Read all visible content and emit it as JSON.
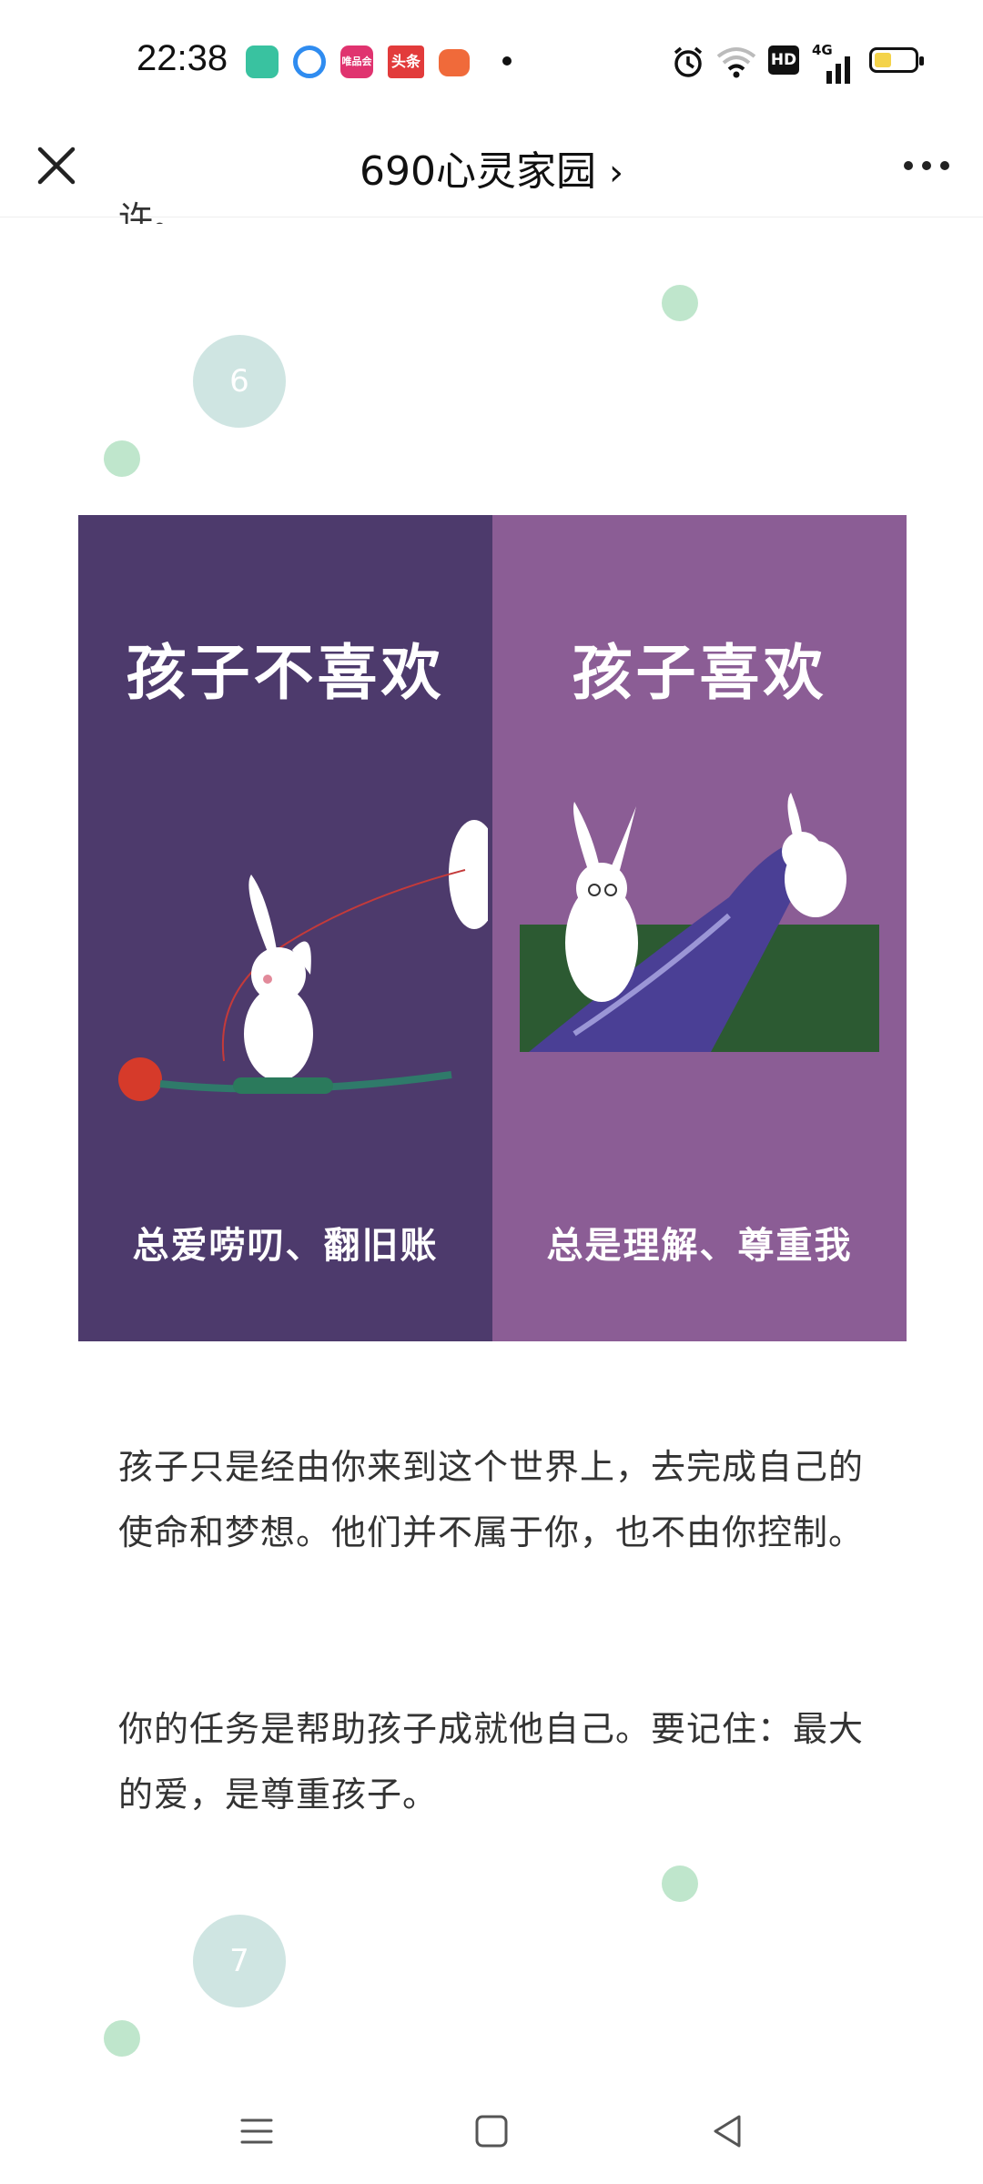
{
  "status": {
    "time": "22:38",
    "apps": [
      {
        "name": "book-app-icon",
        "color": "#39c2a0",
        "label": ""
      },
      {
        "name": "browser-app-icon",
        "color": "#2f8cf0",
        "label": ""
      },
      {
        "name": "vip-app-icon",
        "color": "#e0336f",
        "label": "唯品会"
      },
      {
        "name": "toutiao-app-icon",
        "color": "#e23b3b",
        "label": "头条"
      },
      {
        "name": "game-app-icon",
        "color": "#f06a3a",
        "label": ""
      }
    ],
    "hd_label": "HD",
    "network_label": "4G"
  },
  "header": {
    "title": "690心灵家园",
    "chevron": "›"
  },
  "article": {
    "fragment_text": "许。",
    "section6_number": "6",
    "section7_number": "7",
    "image": {
      "left_heading": "孩子不喜欢",
      "left_caption": "总爱唠叨、翻旧账",
      "right_heading": "孩子喜欢",
      "right_caption": "总是理解、尊重我"
    },
    "paragraph1": "孩子只是经由你来到这个世界上，去完成自己的使命和梦想。他们并不属于你，也不由你控制。",
    "paragraph2": "你的任务是帮助孩子成就他自己。要记住：最大的爱，是尊重孩子。"
  },
  "colors": {
    "accent_green": "#bfe6cc",
    "number_circle": "#cfe5e2",
    "left_panel": "#4d3a6c",
    "right_panel": "#8b5d95"
  }
}
